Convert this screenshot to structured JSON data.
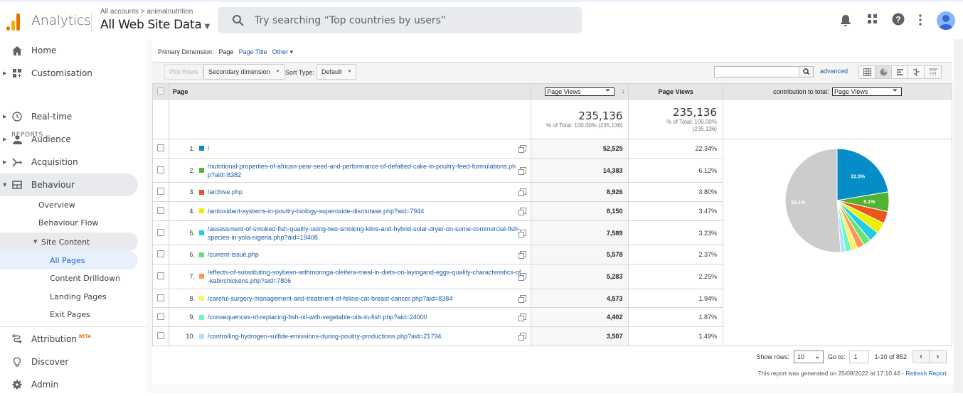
{
  "header": {
    "app_name": "Analytics",
    "breadcrumb": "All accounts > animalnutrition",
    "property": "All Web Site Data",
    "search_placeholder": "Try searching “Top countries by users”",
    "icons": [
      "bell-icon",
      "apps-grid-icon",
      "help-icon",
      "more-vert-icon",
      "account-avatar"
    ]
  },
  "sidebar": {
    "home": "Home",
    "customisation": "Customisation",
    "reports_heading": "REPORTS",
    "realtime": "Real-time",
    "audience": "Audience",
    "acquisition": "Acquisition",
    "behaviour": "Behaviour",
    "overview": "Overview",
    "behaviour_flow": "Behaviour Flow",
    "site_content": "Site Content",
    "all_pages": "All Pages",
    "content_drilldown": "Content Drilldown",
    "landing_pages": "Landing Pages",
    "exit_pages": "Exit Pages",
    "attribution": "Attribution",
    "beta": "BETA",
    "discover": "Discover",
    "admin": "Admin"
  },
  "report": {
    "primary_dimension_label": "Primary Dimension:",
    "primary_dimension_options": [
      "Page",
      "Page Title",
      "Other"
    ],
    "primary_dimension_selected": "Page",
    "other_label": "Other ▾",
    "plot_rows": "Plot Rows",
    "secondary_dimension": "Secondary dimension",
    "sort_type_label": "Sort Type:",
    "sort_type_value": "Default",
    "filter_value": "",
    "advanced": "advanced",
    "col_page": "Page",
    "col_metric_select": "Page Views",
    "col_page_views": "Page Views",
    "col_contribution_label": "contribution to total:",
    "col_contribution_select": "Page Views",
    "total_value": "235,136",
    "total_sub_1": "% of Total: 100.00% (235,136)",
    "total_value_2": "235,136",
    "total_sub_2": "% of Total: 100.00% (235,136)",
    "rows": [
      {
        "n": "1.",
        "page": "/",
        "views": "52,525",
        "pct": "22.34%",
        "color": "#058dc7"
      },
      {
        "n": "2.",
        "page": "/nutritional-properties-of-african-pear-seed-and-performance-of-defatted-cake-in-poultry-feed-formulations.php?aid=8382",
        "views": "14,383",
        "pct": "6.12%",
        "color": "#50b432"
      },
      {
        "n": "3.",
        "page": "/archive.php",
        "views": "8,926",
        "pct": "3.80%",
        "color": "#ed561b"
      },
      {
        "n": "4.",
        "page": "/antioxidant-systems-in-poultry-biology-superoxide-dismutase.php?aid=7944",
        "views": "8,150",
        "pct": "3.47%",
        "color": "#edef00"
      },
      {
        "n": "5.",
        "page": "/assessment-of-smoked-fish-quality-using-two-smoking-kilns-and-hybrid-solar-dryer-on-some-commercial-fish-species-in-yola-nigeria.php?aid=19408",
        "views": "7,589",
        "pct": "3.23%",
        "color": "#24cbe5"
      },
      {
        "n": "6.",
        "page": "/current-issue.php",
        "views": "5,578",
        "pct": "2.37%",
        "color": "#64e572"
      },
      {
        "n": "7.",
        "page": "/effects-of-substituting-soybean-withmoringa-oleifera-meal-in-diets-on-layingand-eggs-quality-characteristics-of-kabirchickens.php?aid=7806",
        "views": "5,283",
        "pct": "2.25%",
        "color": "#ff9655"
      },
      {
        "n": "8.",
        "page": "/careful-surgery-management-and-treatment-of-feline-cat-breast-cancer.php?aid=8384",
        "views": "4,573",
        "pct": "1.94%",
        "color": "#fff263"
      },
      {
        "n": "9.",
        "page": "/consequences-of-replacing-fish-oil-with-vegetable-oils-in-fish.php?aid=24000",
        "views": "4,402",
        "pct": "1.87%",
        "color": "#6af9c4"
      },
      {
        "n": "10.",
        "page": "/controlling-hydrogen-sulfide-emissions-during-poultry-productions.php?aid=21794",
        "views": "3,507",
        "pct": "1.49%",
        "color": "#b2deff"
      }
    ],
    "show_rows_label": "Show rows:",
    "show_rows_value": "10",
    "goto_label": "Go to:",
    "goto_value": "1",
    "range": "1-10 of 852",
    "generated_text": "This report was generated on 25/08/2022 at 17:10:46 - ",
    "refresh": "Refresh Report"
  },
  "chart_data": {
    "type": "pie",
    "title": "contribution to total: Page Views",
    "categories": [
      "/",
      "/nutritional-properties-...aid=8382",
      "/archive.php",
      "/antioxidant-systems-...aid=7944",
      "/assessment-of-smoked-fish-...aid=19408",
      "/current-issue.php",
      "/effects-of-substituting-soybean-...aid=7806",
      "/careful-surgery-...aid=8384",
      "/consequences-of-replacing-fish-oil-...aid=24000",
      "/controlling-hydrogen-sulfide-...aid=21794",
      "(other)"
    ],
    "values": [
      22.34,
      6.12,
      3.8,
      3.47,
      3.23,
      2.37,
      2.25,
      1.94,
      1.87,
      1.49,
      51.12
    ],
    "colors": [
      "#058dc7",
      "#50b432",
      "#ed561b",
      "#edef00",
      "#24cbe5",
      "#64e572",
      "#ff9655",
      "#fff263",
      "#6af9c4",
      "#b2deff",
      "#cccccc"
    ],
    "labels": {
      "0": "22.3%",
      "1": "6.1%",
      "10": "51.1%"
    }
  }
}
